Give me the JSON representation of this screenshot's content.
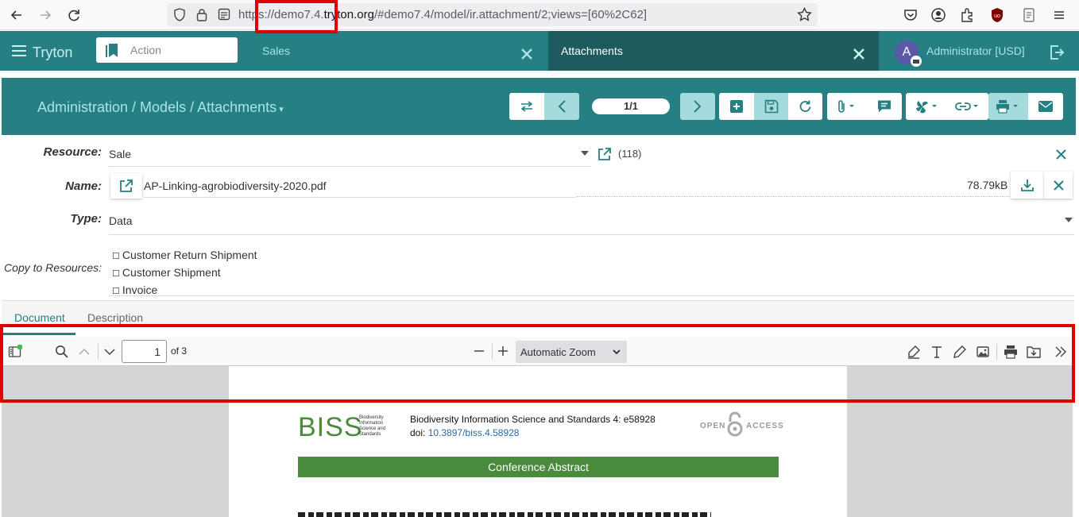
{
  "browser": {
    "url_prefix": "https://",
    "url_host_pre": "demo7.4.",
    "url_host": "tryton.org",
    "url_rest": "/#demo7.4/model/ir.attachment/2;views=[60%2C62]"
  },
  "topbar": {
    "brand": "Tryton",
    "action_placeholder": "Action",
    "tabs": [
      "Sales",
      "Attachments"
    ],
    "user": "Administrator [USD]",
    "avatar_letter": "A"
  },
  "header": {
    "breadcrumb": "Administration / Models / Attachments",
    "pager": "1/1"
  },
  "form": {
    "resource_label": "Resource:",
    "resource_value": "Sale",
    "resource_id": "(118)",
    "name_label": "Name:",
    "name_value": "AP-Linking-agrobiodiversity-2020.pdf",
    "file_size": "78.79kB",
    "type_label": "Type:",
    "type_value": "Data",
    "copy_label": "Copy to Resources:",
    "copy_options": [
      "Customer Return Shipment",
      "Customer Shipment",
      "Invoice"
    ]
  },
  "tabs": [
    "Document",
    "Description"
  ],
  "pdf": {
    "page": "1",
    "page_count": "of 3",
    "zoom": "Automatic Zoom",
    "journal_logo": "BISS",
    "journal_logo_sub": "Biodiversity Information Science and Standards",
    "journal_line": "Biodiversity Information Science and Standards 4: e58928",
    "doi_label": "doi:",
    "doi": "10.3897/biss.4.58928",
    "open_access_left": "OPEN",
    "open_access_right": "ACCESS",
    "section_banner": "Conference Abstract"
  },
  "colors": {
    "brand_teal": "#267f82",
    "dark_teal": "#1d5b5e",
    "highlight_red": "#e00000",
    "biss_green": "#4a8a3c"
  }
}
